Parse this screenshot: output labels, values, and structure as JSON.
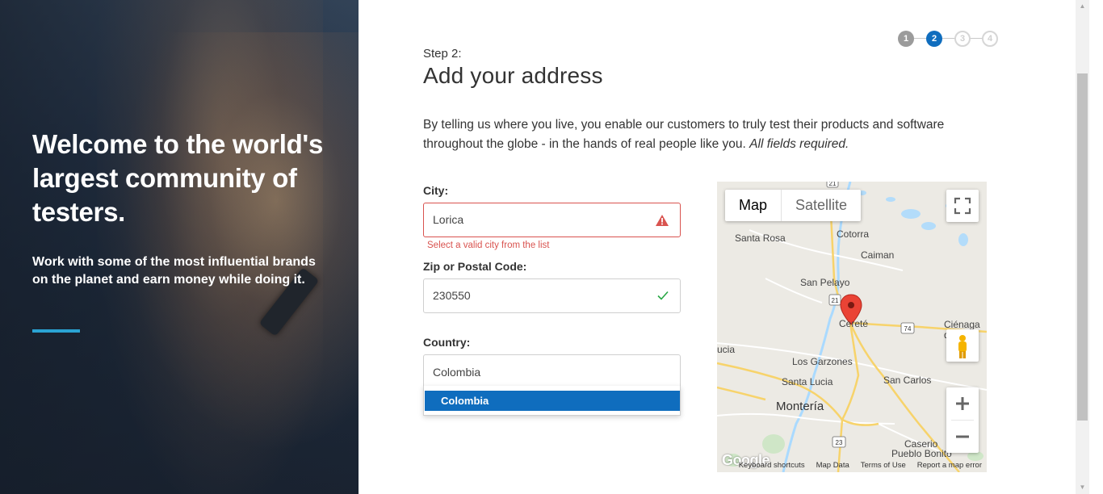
{
  "hero": {
    "title": "Welcome to the world's largest community of testers.",
    "subtitle": "Work with some of the most influential brands on the planet and earn money while doing it.",
    "accent_color": "#2aa3d3"
  },
  "stepper": {
    "steps": [
      "1",
      "2",
      "3",
      "4"
    ],
    "current": 2
  },
  "header": {
    "step_label": "Step 2:",
    "title": "Add your address"
  },
  "intro": {
    "text": "By telling us where you live, you enable our customers to truly test their products and software throughout the globe - in the hands of real people like you.",
    "required_note": "All fields required."
  },
  "form": {
    "city": {
      "label": "City:",
      "value": "Lorica",
      "error": "Select a valid city from the list",
      "status": "warning-icon"
    },
    "zip": {
      "label": "Zip or Postal Code:",
      "value": "230550",
      "status": "check-icon"
    },
    "country": {
      "label": "Country:",
      "value": "Colombia",
      "options": [
        "Colombia"
      ]
    }
  },
  "map": {
    "type_buttons": [
      "Map",
      "Satellite"
    ],
    "selected_type": "Map",
    "labels": {
      "santa_rosa": "Santa Rosa",
      "cotorra": "Cotorra",
      "caiman": "Caiman",
      "san_pelayo": "San Pelayo",
      "cerete": "Cereté",
      "cienaga": "Ciénaga",
      "cienaga2": "de",
      "lucia": "ucia",
      "los_garzones": "Los Garzones",
      "santa_lucia": "Santa Lucia",
      "san_carlos": "San Carlos",
      "monteria": "Montería",
      "caserio": "Caserio",
      "pueblo_bonito": "Pueblo Bonito"
    },
    "road_shields": [
      "21",
      "21",
      "74",
      "23"
    ],
    "footer": [
      "Keyboard shortcuts",
      "Map Data",
      "Terms of Use",
      "Report a map error"
    ],
    "logo": "Google",
    "pin_color": "#ea4335"
  }
}
